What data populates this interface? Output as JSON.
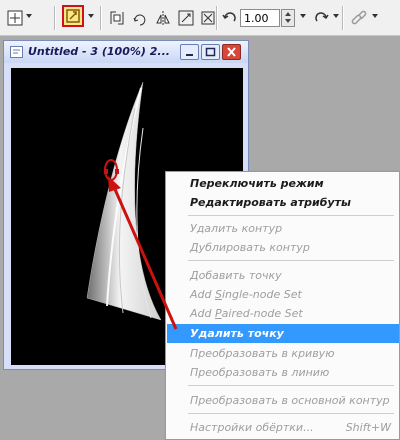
{
  "toolbar": {
    "zoom_value": "1.00",
    "icons": [
      "pick-tool-icon",
      "shape-tool-icon",
      "node-edit-icon",
      "rotate-icon",
      "mirror-icon",
      "scale-icon",
      "transform-icon",
      "undo-icon",
      "redo-icon",
      "link-icon"
    ]
  },
  "doc_window": {
    "title": "Untitled - 3 (100%) 2..."
  },
  "context_menu": {
    "items": [
      {
        "label": "Переключить режим",
        "enabled": true
      },
      {
        "label": "Редактировать атрибуты",
        "enabled": true
      },
      {
        "label": "Удалить контур",
        "enabled": false
      },
      {
        "label": "Дублировать контур",
        "enabled": false
      },
      {
        "label": "Добавить точку",
        "enabled": false
      },
      {
        "label_pre": "Add ",
        "label_u": "S",
        "label_post": "ingle-node Set",
        "enabled": false
      },
      {
        "label_pre": "Add ",
        "label_u": "P",
        "label_post": "aired-node Set",
        "enabled": false
      },
      {
        "label": "Удалить точку",
        "enabled": true,
        "highlighted": true
      },
      {
        "label": "Преобразовать в кривую",
        "enabled": false
      },
      {
        "label": "Преобразовать в линию",
        "enabled": false
      },
      {
        "label": "Преобразовать в основной контур",
        "enabled": false
      },
      {
        "label": "Настройки обёртки...",
        "shortcut": "Shift+W",
        "enabled": false
      }
    ]
  },
  "colors": {
    "accent": "#3399ff",
    "annotation": "#cc1111",
    "canvas": "#000000"
  }
}
